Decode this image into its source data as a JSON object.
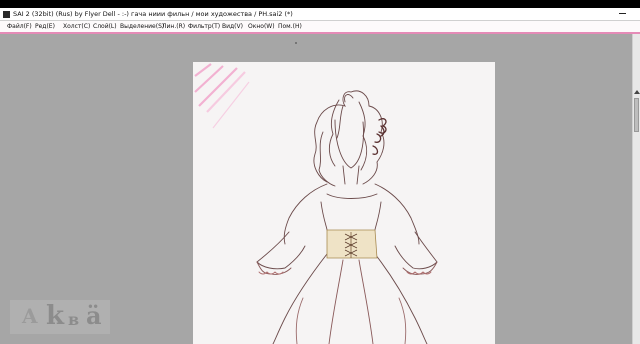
{
  "window": {
    "title": "SAI 2 (32bit) (Rus) by Flyer Dell - :-)  гача ниии фильн / мои художества / PH.sai2 (*)"
  },
  "menu": {
    "items": [
      {
        "label": "Файл(F)"
      },
      {
        "label": "Ред(E)"
      },
      {
        "label": "Холст(C)"
      },
      {
        "label": "Слой(L)"
      },
      {
        "label": "Выделение(S)"
      },
      {
        "label": "Лин.(R)"
      },
      {
        "label": "Фильтр(T)"
      },
      {
        "label": "Вид(V)"
      },
      {
        "label": "Окно(W)"
      },
      {
        "label": "Пом.(H)"
      }
    ]
  },
  "watermark": {
    "letters": [
      "A",
      "k",
      "в",
      "ä"
    ]
  },
  "colors": {
    "menu_accent": "#e58bb7",
    "workspace": "#a6a6a6",
    "canvas": "#f6f4f4",
    "line_art": "#6b4a4a",
    "corset": "#c9b07a"
  }
}
